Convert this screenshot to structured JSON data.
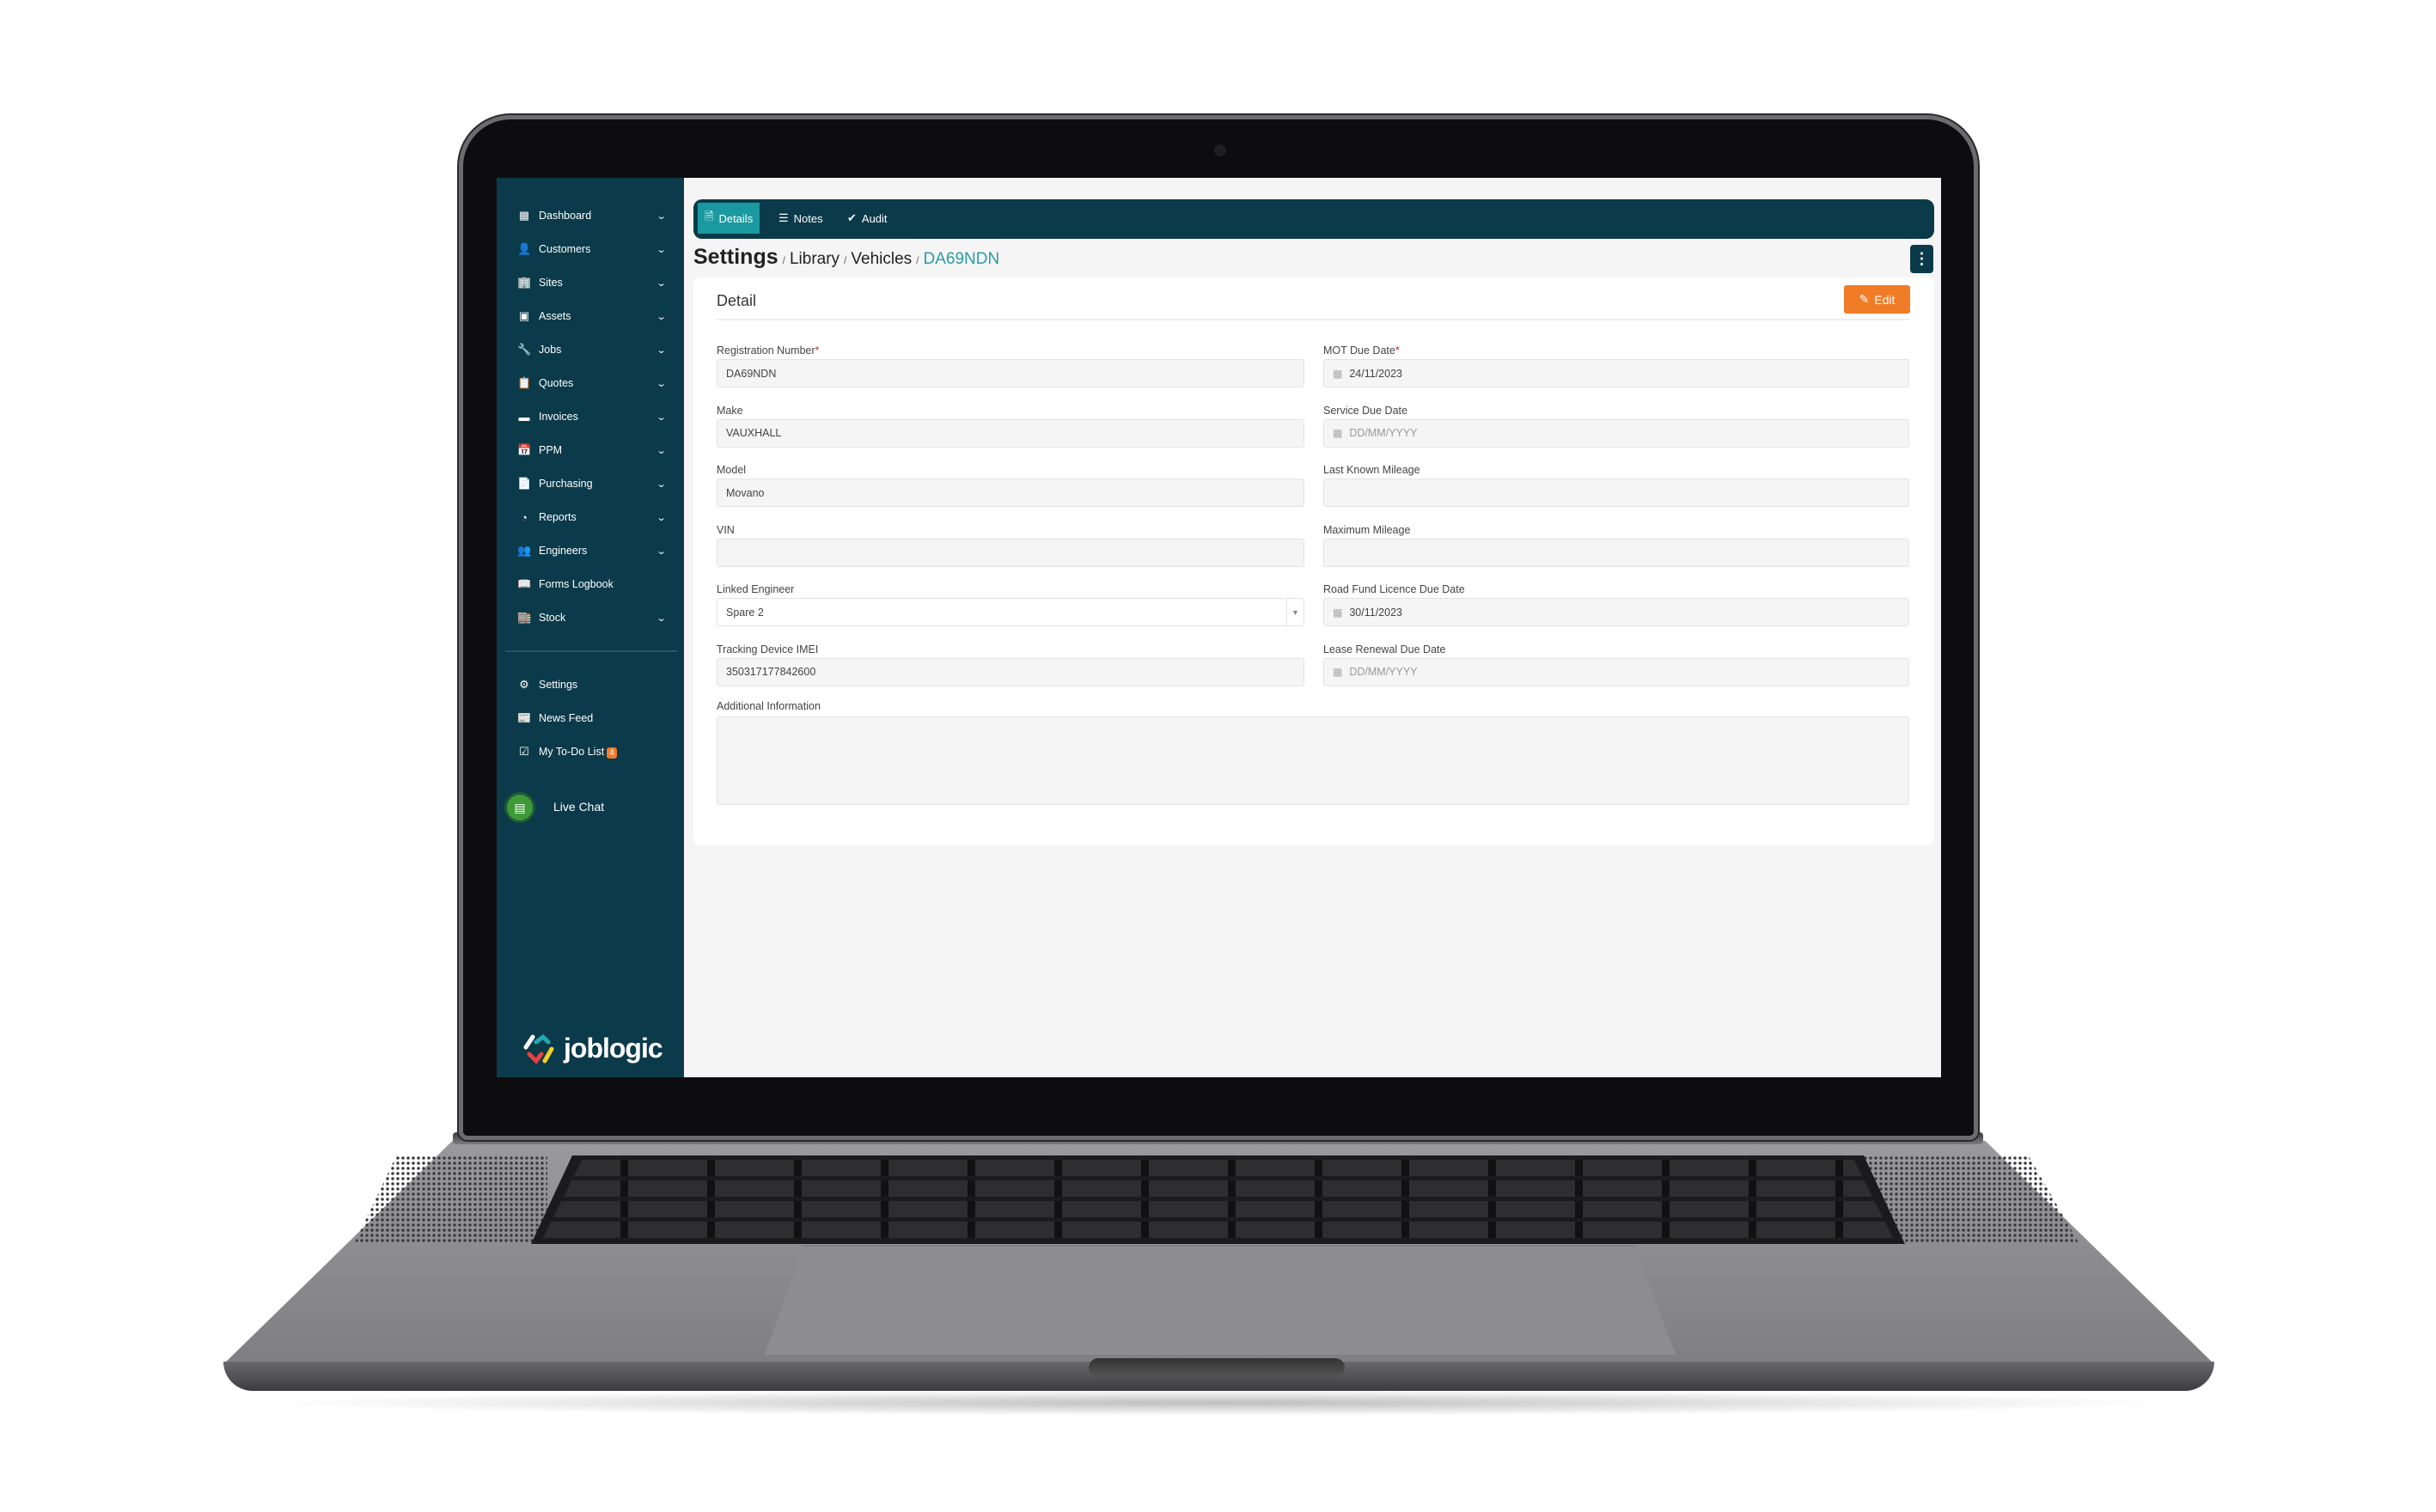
{
  "colors": {
    "sidebar": "#0b3a4a",
    "active_tab": "#1a9aa0",
    "accent": "#2a9aa8",
    "edit_button": "#f07c28",
    "badge": "#f07c28",
    "live_chat": "#3e9a37"
  },
  "sidebar": {
    "items": [
      {
        "label": "Dashboard",
        "icon": "dashboard-icon",
        "glyph": "▦",
        "chevron": true
      },
      {
        "label": "Customers",
        "icon": "user-icon",
        "glyph": "👤",
        "chevron": true
      },
      {
        "label": "Sites",
        "icon": "building-icon",
        "glyph": "🏢",
        "chevron": true
      },
      {
        "label": "Assets",
        "icon": "asset-icon",
        "glyph": "▣",
        "chevron": true
      },
      {
        "label": "Jobs",
        "icon": "wrench-icon",
        "glyph": "🔧",
        "chevron": true
      },
      {
        "label": "Quotes",
        "icon": "clipboard-icon",
        "glyph": "📋",
        "chevron": true
      },
      {
        "label": "Invoices",
        "icon": "invoice-icon",
        "glyph": "▬",
        "chevron": true
      },
      {
        "label": "PPM",
        "icon": "calendar-check-icon",
        "glyph": "📅",
        "chevron": true
      },
      {
        "label": "Purchasing",
        "icon": "document-icon",
        "glyph": "📄",
        "chevron": true
      },
      {
        "label": "Reports",
        "icon": "pie-chart-icon",
        "glyph": "◔",
        "chevron": true
      },
      {
        "label": "Engineers",
        "icon": "users-icon",
        "glyph": "👥",
        "chevron": true
      },
      {
        "label": "Forms Logbook",
        "icon": "book-icon",
        "glyph": "📖",
        "chevron": false
      },
      {
        "label": "Stock",
        "icon": "warehouse-icon",
        "glyph": "🏬",
        "chevron": true
      }
    ],
    "bottom_items": [
      {
        "label": "Settings",
        "icon": "user-gear-icon",
        "glyph": "⚙"
      },
      {
        "label": "News Feed",
        "icon": "newspaper-icon",
        "glyph": "📰"
      },
      {
        "label": "My To-Do List",
        "icon": "checklist-icon",
        "glyph": "☑",
        "badge": "4"
      }
    ],
    "live_chat": "Live Chat",
    "logo": "joblogic"
  },
  "tabs": [
    {
      "label": "Details",
      "icon": "document-icon",
      "active": true
    },
    {
      "label": "Notes",
      "icon": "notes-icon",
      "active": false
    },
    {
      "label": "Audit",
      "icon": "check-circle-icon",
      "active": false
    }
  ],
  "breadcrumb": {
    "root": "Settings",
    "items": [
      "Library",
      "Vehicles"
    ],
    "current": "DA69NDN",
    "separator": "/"
  },
  "card": {
    "title": "Detail",
    "edit_label": "Edit",
    "left_fields": [
      {
        "label": "Registration Number",
        "required": true,
        "value": "DA69NDN",
        "placeholder": ""
      },
      {
        "label": "Make",
        "required": false,
        "value": "VAUXHALL",
        "placeholder": ""
      },
      {
        "label": "Model",
        "required": false,
        "value": "Movano",
        "placeholder": ""
      },
      {
        "label": "VIN",
        "required": false,
        "value": "",
        "placeholder": ""
      },
      {
        "label": "Linked Engineer",
        "required": false,
        "value": "Spare 2",
        "placeholder": "",
        "select": true
      },
      {
        "label": "Tracking Device IMEI",
        "required": false,
        "value": "350317177842600",
        "placeholder": ""
      }
    ],
    "right_fields": [
      {
        "label": "MOT Due Date",
        "required": true,
        "value": "24/11/2023",
        "placeholder": "DD/MM/YYYY",
        "date": true
      },
      {
        "label": "Service Due Date",
        "required": false,
        "value": "",
        "placeholder": "DD/MM/YYYY",
        "date": true
      },
      {
        "label": "Last Known Mileage",
        "required": false,
        "value": "",
        "placeholder": ""
      },
      {
        "label": "Maximum Mileage",
        "required": false,
        "value": "",
        "placeholder": ""
      },
      {
        "label": "Road Fund Licence Due Date",
        "required": false,
        "value": "30/11/2023",
        "placeholder": "DD/MM/YYYY",
        "date": true
      },
      {
        "label": "Lease Renewal Due Date",
        "required": false,
        "value": "",
        "placeholder": "DD/MM/YYYY",
        "date": true
      }
    ],
    "additional_info": {
      "label": "Additional Information",
      "value": ""
    }
  }
}
